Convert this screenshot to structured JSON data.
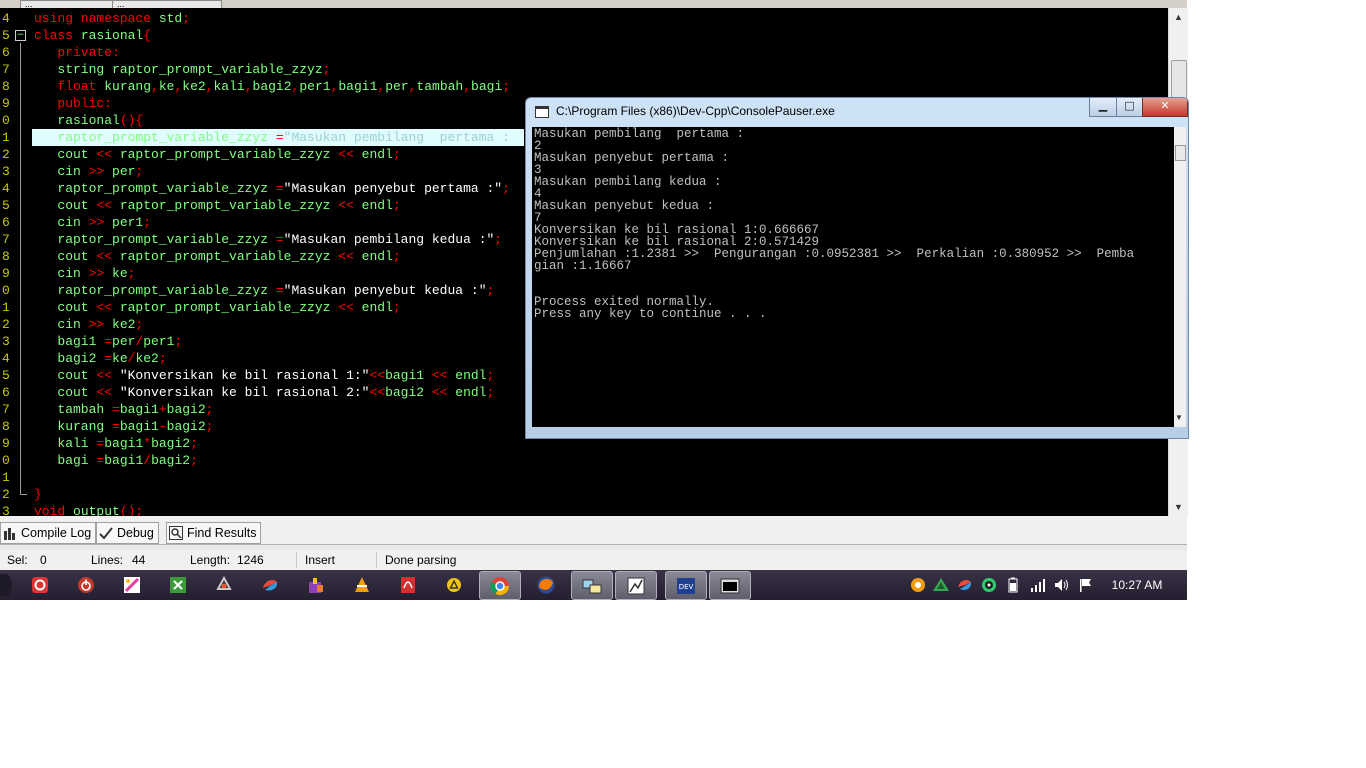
{
  "file_tabs": [
    "...",
    "..."
  ],
  "editor": {
    "lines": [
      {
        "num": "4",
        "fold": "",
        "segs": [
          {
            "t": "using namespace ",
            "c": "#ff0000"
          },
          {
            "t": "std",
            "c": "#80ff80"
          },
          {
            "t": ";",
            "c": "#ff0000"
          }
        ]
      },
      {
        "num": "5",
        "fold": "−",
        "segs": [
          {
            "t": "class ",
            "c": "#ff0000"
          },
          {
            "t": "rasional",
            "c": "#80ff80"
          },
          {
            "t": "{",
            "c": "#ff0000"
          }
        ]
      },
      {
        "num": "6",
        "fold": "",
        "segs": [
          {
            "t": "   private:",
            "c": "#ff0000"
          }
        ]
      },
      {
        "num": "7",
        "fold": "",
        "segs": [
          {
            "t": "   string raptor_prompt_variable_zzyz",
            "c": "#80ff80"
          },
          {
            "t": ";",
            "c": "#ff0000"
          }
        ]
      },
      {
        "num": "8",
        "fold": "",
        "segs": [
          {
            "t": "   float ",
            "c": "#ff0000"
          },
          {
            "t": "kurang",
            "c": "#80ff80"
          },
          {
            "t": ",",
            "c": "#ff0000"
          },
          {
            "t": "ke",
            "c": "#80ff80"
          },
          {
            "t": ",",
            "c": "#ff0000"
          },
          {
            "t": "ke2",
            "c": "#80ff80"
          },
          {
            "t": ",",
            "c": "#ff0000"
          },
          {
            "t": "kali",
            "c": "#80ff80"
          },
          {
            "t": ",",
            "c": "#ff0000"
          },
          {
            "t": "bagi2",
            "c": "#80ff80"
          },
          {
            "t": ",",
            "c": "#ff0000"
          },
          {
            "t": "per1",
            "c": "#80ff80"
          },
          {
            "t": ",",
            "c": "#ff0000"
          },
          {
            "t": "bagi1",
            "c": "#80ff80"
          },
          {
            "t": ",",
            "c": "#ff0000"
          },
          {
            "t": "per",
            "c": "#80ff80"
          },
          {
            "t": ",",
            "c": "#ff0000"
          },
          {
            "t": "tambah",
            "c": "#80ff80"
          },
          {
            "t": ",",
            "c": "#ff0000"
          },
          {
            "t": "bagi",
            "c": "#80ff80"
          },
          {
            "t": ";",
            "c": "#ff0000"
          }
        ]
      },
      {
        "num": "9",
        "fold": "",
        "segs": [
          {
            "t": "   public:",
            "c": "#ff0000"
          }
        ]
      },
      {
        "num": "0",
        "fold": "",
        "segs": [
          {
            "t": "   rasional",
            "c": "#80ff80"
          },
          {
            "t": "(){",
            "c": "#ff0000"
          }
        ]
      },
      {
        "num": "1",
        "fold": "",
        "hl": true,
        "segs": [
          {
            "t": "   raptor_prompt_variable_zzyz ",
            "c": "#80ff80"
          },
          {
            "t": "=",
            "c": "#ff0000"
          },
          {
            "t": "\"Masukan pembilang  pertama :",
            "c": "#a0d0d0"
          }
        ]
      },
      {
        "num": "2",
        "fold": "",
        "segs": [
          {
            "t": "   cout ",
            "c": "#80ff80"
          },
          {
            "t": "<< ",
            "c": "#ff0000"
          },
          {
            "t": "raptor_prompt_variable_zzyz ",
            "c": "#80ff80"
          },
          {
            "t": "<< ",
            "c": "#ff0000"
          },
          {
            "t": "endl",
            "c": "#80ff80"
          },
          {
            "t": ";",
            "c": "#ff0000"
          }
        ]
      },
      {
        "num": "3",
        "fold": "",
        "segs": [
          {
            "t": "   cin ",
            "c": "#80ff80"
          },
          {
            "t": ">> ",
            "c": "#ff0000"
          },
          {
            "t": "per",
            "c": "#80ff80"
          },
          {
            "t": ";",
            "c": "#ff0000"
          }
        ]
      },
      {
        "num": "4",
        "fold": "",
        "segs": [
          {
            "t": "   raptor_prompt_variable_zzyz ",
            "c": "#80ff80"
          },
          {
            "t": "=",
            "c": "#ff0000"
          },
          {
            "t": "\"Masukan penyebut pertama :\"",
            "c": "#ffffff"
          },
          {
            "t": ";",
            "c": "#ff0000"
          }
        ]
      },
      {
        "num": "5",
        "fold": "",
        "segs": [
          {
            "t": "   cout ",
            "c": "#80ff80"
          },
          {
            "t": "<< ",
            "c": "#ff0000"
          },
          {
            "t": "raptor_prompt_variable_zzyz ",
            "c": "#80ff80"
          },
          {
            "t": "<< ",
            "c": "#ff0000"
          },
          {
            "t": "endl",
            "c": "#80ff80"
          },
          {
            "t": ";",
            "c": "#ff0000"
          }
        ]
      },
      {
        "num": "6",
        "fold": "",
        "segs": [
          {
            "t": "   cin ",
            "c": "#80ff80"
          },
          {
            "t": ">> ",
            "c": "#ff0000"
          },
          {
            "t": "per1",
            "c": "#80ff80"
          },
          {
            "t": ";",
            "c": "#ff0000"
          }
        ]
      },
      {
        "num": "7",
        "fold": "",
        "segs": [
          {
            "t": "   raptor_prompt_variable_zzyz ",
            "c": "#80ff80"
          },
          {
            "t": "=",
            "c": "#ff0000"
          },
          {
            "t": "\"Masukan pembilang kedua :\"",
            "c": "#ffffff"
          },
          {
            "t": ";",
            "c": "#ff0000"
          }
        ]
      },
      {
        "num": "8",
        "fold": "",
        "segs": [
          {
            "t": "   cout ",
            "c": "#80ff80"
          },
          {
            "t": "<< ",
            "c": "#ff0000"
          },
          {
            "t": "raptor_prompt_variable_zzyz ",
            "c": "#80ff80"
          },
          {
            "t": "<< ",
            "c": "#ff0000"
          },
          {
            "t": "endl",
            "c": "#80ff80"
          },
          {
            "t": ";",
            "c": "#ff0000"
          }
        ]
      },
      {
        "num": "9",
        "fold": "",
        "segs": [
          {
            "t": "   cin ",
            "c": "#80ff80"
          },
          {
            "t": ">> ",
            "c": "#ff0000"
          },
          {
            "t": "ke",
            "c": "#80ff80"
          },
          {
            "t": ";",
            "c": "#ff0000"
          }
        ]
      },
      {
        "num": "0",
        "fold": "",
        "segs": [
          {
            "t": "   raptor_prompt_variable_zzyz ",
            "c": "#80ff80"
          },
          {
            "t": "=",
            "c": "#ff0000"
          },
          {
            "t": "\"Masukan penyebut kedua :\"",
            "c": "#ffffff"
          },
          {
            "t": ";",
            "c": "#ff0000"
          }
        ]
      },
      {
        "num": "1",
        "fold": "",
        "segs": [
          {
            "t": "   cout ",
            "c": "#80ff80"
          },
          {
            "t": "<< ",
            "c": "#ff0000"
          },
          {
            "t": "raptor_prompt_variable_zzyz ",
            "c": "#80ff80"
          },
          {
            "t": "<< ",
            "c": "#ff0000"
          },
          {
            "t": "endl",
            "c": "#80ff80"
          },
          {
            "t": ";",
            "c": "#ff0000"
          }
        ]
      },
      {
        "num": "2",
        "fold": "",
        "segs": [
          {
            "t": "   cin ",
            "c": "#80ff80"
          },
          {
            "t": ">> ",
            "c": "#ff0000"
          },
          {
            "t": "ke2",
            "c": "#80ff80"
          },
          {
            "t": ";",
            "c": "#ff0000"
          }
        ]
      },
      {
        "num": "3",
        "fold": "",
        "segs": [
          {
            "t": "   bagi1 ",
            "c": "#80ff80"
          },
          {
            "t": "=",
            "c": "#ff0000"
          },
          {
            "t": "per",
            "c": "#80ff80"
          },
          {
            "t": "/",
            "c": "#ff0000"
          },
          {
            "t": "per1",
            "c": "#80ff80"
          },
          {
            "t": ";",
            "c": "#ff0000"
          }
        ]
      },
      {
        "num": "4",
        "fold": "",
        "segs": [
          {
            "t": "   bagi2 ",
            "c": "#80ff80"
          },
          {
            "t": "=",
            "c": "#ff0000"
          },
          {
            "t": "ke",
            "c": "#80ff80"
          },
          {
            "t": "/",
            "c": "#ff0000"
          },
          {
            "t": "ke2",
            "c": "#80ff80"
          },
          {
            "t": ";",
            "c": "#ff0000"
          }
        ]
      },
      {
        "num": "5",
        "fold": "",
        "segs": [
          {
            "t": "   cout ",
            "c": "#80ff80"
          },
          {
            "t": "<< ",
            "c": "#ff0000"
          },
          {
            "t": "\"Konversikan ke bil rasional 1:\"",
            "c": "#ffffff"
          },
          {
            "t": "<<",
            "c": "#ff0000"
          },
          {
            "t": "bagi1 ",
            "c": "#80ff80"
          },
          {
            "t": "<< ",
            "c": "#ff0000"
          },
          {
            "t": "endl",
            "c": "#80ff80"
          },
          {
            "t": ";",
            "c": "#ff0000"
          }
        ]
      },
      {
        "num": "6",
        "fold": "",
        "segs": [
          {
            "t": "   cout ",
            "c": "#80ff80"
          },
          {
            "t": "<< ",
            "c": "#ff0000"
          },
          {
            "t": "\"Konversikan ke bil rasional 2:\"",
            "c": "#ffffff"
          },
          {
            "t": "<<",
            "c": "#ff0000"
          },
          {
            "t": "bagi2 ",
            "c": "#80ff80"
          },
          {
            "t": "<< ",
            "c": "#ff0000"
          },
          {
            "t": "endl",
            "c": "#80ff80"
          },
          {
            "t": ";",
            "c": "#ff0000"
          }
        ]
      },
      {
        "num": "7",
        "fold": "",
        "segs": [
          {
            "t": "   tambah ",
            "c": "#80ff80"
          },
          {
            "t": "=",
            "c": "#ff0000"
          },
          {
            "t": "bagi1",
            "c": "#80ff80"
          },
          {
            "t": "+",
            "c": "#ff0000"
          },
          {
            "t": "bagi2",
            "c": "#80ff80"
          },
          {
            "t": ";",
            "c": "#ff0000"
          }
        ]
      },
      {
        "num": "8",
        "fold": "",
        "segs": [
          {
            "t": "   kurang ",
            "c": "#80ff80"
          },
          {
            "t": "=",
            "c": "#ff0000"
          },
          {
            "t": "bagi1",
            "c": "#80ff80"
          },
          {
            "t": "-",
            "c": "#ff0000"
          },
          {
            "t": "bagi2",
            "c": "#80ff80"
          },
          {
            "t": ";",
            "c": "#ff0000"
          }
        ]
      },
      {
        "num": "9",
        "fold": "",
        "segs": [
          {
            "t": "   kali ",
            "c": "#80ff80"
          },
          {
            "t": "=",
            "c": "#ff0000"
          },
          {
            "t": "bagi1",
            "c": "#80ff80"
          },
          {
            "t": "*",
            "c": "#ff0000"
          },
          {
            "t": "bagi2",
            "c": "#80ff80"
          },
          {
            "t": ";",
            "c": "#ff0000"
          }
        ]
      },
      {
        "num": "0",
        "fold": "",
        "segs": [
          {
            "t": "   bagi ",
            "c": "#80ff80"
          },
          {
            "t": "=",
            "c": "#ff0000"
          },
          {
            "t": "bagi1",
            "c": "#80ff80"
          },
          {
            "t": "/",
            "c": "#ff0000"
          },
          {
            "t": "bagi2",
            "c": "#80ff80"
          },
          {
            "t": ";",
            "c": "#ff0000"
          }
        ]
      },
      {
        "num": "1",
        "fold": "",
        "segs": []
      },
      {
        "num": "2",
        "fold": "end",
        "segs": [
          {
            "t": "}",
            "c": "#ff0000"
          }
        ]
      },
      {
        "num": "3",
        "fold": "",
        "segs": [
          {
            "t": "void ",
            "c": "#ff0000"
          },
          {
            "t": "output",
            "c": "#80ff80"
          },
          {
            "t": "();",
            "c": "#ff0000"
          }
        ]
      }
    ]
  },
  "console": {
    "title": "C:\\Program Files (x86)\\Dev-Cpp\\ConsolePauser.exe",
    "minimize": "▁",
    "maximize": "□",
    "close": "✕",
    "lines": [
      "Masukan pembilang  pertama :",
      "2",
      "Masukan penyebut pertama :",
      "3",
      "Masukan pembilang kedua :",
      "4",
      "Masukan penyebut kedua :",
      "7",
      "Konversikan ke bil rasional 1:0.666667",
      "Konversikan ke bil rasional 2:0.571429",
      "Penjumlahan :1.2381 >>  Pengurangan :0.0952381 >>  Perkalian :0.380952 >>  Pemba",
      "gian :1.16667",
      "",
      "",
      "Process exited normally.",
      "Press any key to continue . . ."
    ]
  },
  "bottom_tabs": {
    "compile_log": "Compile Log",
    "debug": "Debug",
    "find_results": "Find Results"
  },
  "status": {
    "sel_label": "Sel:",
    "sel_value": "0",
    "lines_label": "Lines:",
    "lines_value": "44",
    "length_label": "Length:",
    "length_value": "1246",
    "mode": "Insert",
    "message": "Done parsing"
  },
  "taskbar": {
    "apps": [
      "start-icon",
      "opera-icon",
      "power-icon",
      "paint-icon",
      "excel-icon",
      "chrome-like-icon",
      "recycle-icon",
      "setup-icon",
      "vlc-icon",
      "pdf-icon",
      "warning-icon",
      "chrome-icon",
      "firefox-icon",
      "network-icon",
      "image-tool-icon",
      "devcpp-icon",
      "console-icon"
    ],
    "time": "10:27 AM"
  }
}
